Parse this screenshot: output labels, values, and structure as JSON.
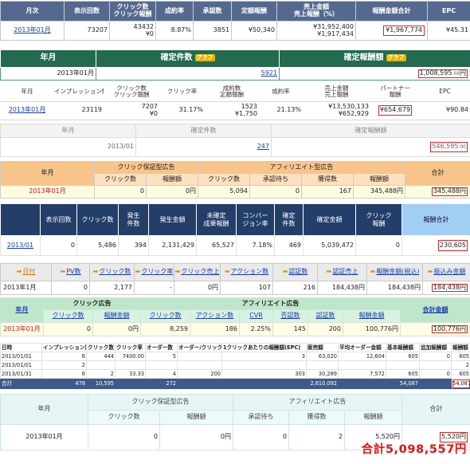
{
  "s1": {
    "headers": [
      "月次",
      "表示回数",
      "クリック数\nクリック報酬",
      "成約率",
      "承認数",
      "定額報酬",
      "売上金額\n売上報酬（%）",
      "報酬金額合計",
      "EPC"
    ],
    "month": "2013年01月",
    "views": "73207",
    "clicks": "43432",
    "click_reward": "¥0",
    "conv_rate": "8.87%",
    "approved": "3851",
    "fixed_reward": "¥50,340",
    "sales": "¥31,952,400",
    "sales_reward": "¥1,917,434",
    "total": "¥1,967,774",
    "epc": "¥45.31"
  },
  "s2": {
    "h_month": "年月",
    "h_count": "確定件数",
    "h_amount": "確定報酬額",
    "graph": "グラフ",
    "month": "2013年01月",
    "count": "5921",
    "amount_main": "1,008,595",
    "amount_dec": ".68",
    "amount_unit": "円"
  },
  "s3": {
    "headers": [
      "年月",
      "インプレッション数",
      "クリック数\nクリック報酬",
      "クリック率",
      "成約数\n定額報酬",
      "成約率",
      "売上金額\n売上報酬",
      "パートナー\n報酬",
      "EPC"
    ],
    "month": "2013年01月",
    "impressions": "23119",
    "clicks": "7207",
    "click_reward": "¥0",
    "click_rate": "31.17%",
    "conversions": "1523",
    "fixed_reward": "¥1,750",
    "conv_rate": "21.13%",
    "sales": "¥13,530,133",
    "sales_reward": "¥652,929",
    "partner": "¥654,679",
    "epc": "¥90.84"
  },
  "s4": {
    "h_month": "年月",
    "h_count": "確定件数",
    "h_amount": "確定報酬額",
    "month": "2013/01",
    "count": "247",
    "amount_main": "546,595",
    "amount_dec": ".00"
  },
  "s5": {
    "h_month": "年月",
    "h_click": "クリック保証型広告",
    "h_aff": "アフィリエイト型広告",
    "h_total": "合計",
    "sub": [
      "クリック数",
      "報酬額",
      "クリック数",
      "承認待ち",
      "獲得数",
      "報酬額"
    ],
    "month": "2013年01月",
    "vals": [
      "0",
      "0円",
      "5,094",
      "0",
      "167",
      "345,488円"
    ],
    "total": "345,488円"
  },
  "s6": {
    "headers": [
      "表示回数",
      "クリック数",
      "発生\n件数",
      "発生金額",
      "未確定\n成果報酬",
      "コンバー\nジョン率",
      "確定\n件数",
      "確定金額",
      "クリック\n報酬",
      "報酬合計"
    ],
    "month": "2013/01",
    "vals": [
      "0",
      "5,486",
      "394",
      "2,131,429",
      "65,527",
      "7.18%",
      "469",
      "5,039,472",
      "0",
      "230,605"
    ],
    "total": "230,605"
  },
  "s7": {
    "headers": [
      "日付",
      "PV数",
      "クリック数",
      "クリック率",
      "クリック売上",
      "アクション数",
      "認証数",
      "認証売上",
      "報酬金額(税込)",
      "振込み金額"
    ],
    "month": "2013年1月",
    "vals": [
      "0",
      "2,177",
      "-",
      "0円",
      "107",
      "216",
      "184,438円",
      "184,438円"
    ],
    "total": "184,438円"
  },
  "s8": {
    "h_month": "年月",
    "h_click": "クリック広告",
    "h_aff": "アフィリエイト広告",
    "h_total": "合計金額",
    "sub": [
      "クリック数",
      "報酬金額",
      "クリック数",
      "アクション数",
      "CVR",
      "否認数",
      "認証数",
      "報酬金額"
    ],
    "month": "2013年01月",
    "vals": [
      "0",
      "0円",
      "8,259",
      "186",
      "2.25%",
      "145",
      "200",
      "100,776円"
    ],
    "total": "100,776円"
  },
  "s9": {
    "headers": [
      "日時",
      "インプレッション数",
      "クリック数",
      "クリック率",
      "オーダー数",
      "オーダー/クリック",
      "1クリックあたりの報酬額(EPC)",
      "販売額",
      "平均オーダー金額",
      "基本報酬額",
      "追加報酬額",
      "報酬額"
    ],
    "rows": [
      [
        "2013/01/01",
        "6",
        "444",
        "7400.00",
        "5",
        "",
        "3",
        "63,020",
        "12,604",
        "605",
        "0",
        "605"
      ],
      [
        "2013/01/01",
        "2",
        "",
        "",
        "",
        "",
        "",
        "",
        "",
        "",
        "",
        "2"
      ],
      [
        "2013/01/31",
        "6",
        "2",
        "33.33",
        "4",
        "200",
        "303",
        "30,289",
        "7,572",
        "605",
        "0",
        "605"
      ],
      [
        "合計",
        "478",
        "10,595",
        "",
        "272",
        "",
        "",
        "2,610,092",
        "",
        "54,087",
        "",
        "54,087"
      ]
    ]
  },
  "s10": {
    "h_month": "年月",
    "h_click": "クリック保証型広告",
    "h_aff": "アフィリエイト広告",
    "h_total": "合計",
    "sub": [
      "クリック数",
      "報酬額",
      "承認待ち",
      "獲得数",
      "報酬額"
    ],
    "month": "2013年01月",
    "vals": [
      "0",
      "0円",
      "0",
      "2",
      "5,520円"
    ],
    "total": "5,520円"
  },
  "grand_total": "合計5,098,557円",
  "colors": {
    "accent_red": "#d62222",
    "header_blue": "#55698f",
    "header_green": "#236a4e",
    "header_navy": "#243e6a"
  }
}
